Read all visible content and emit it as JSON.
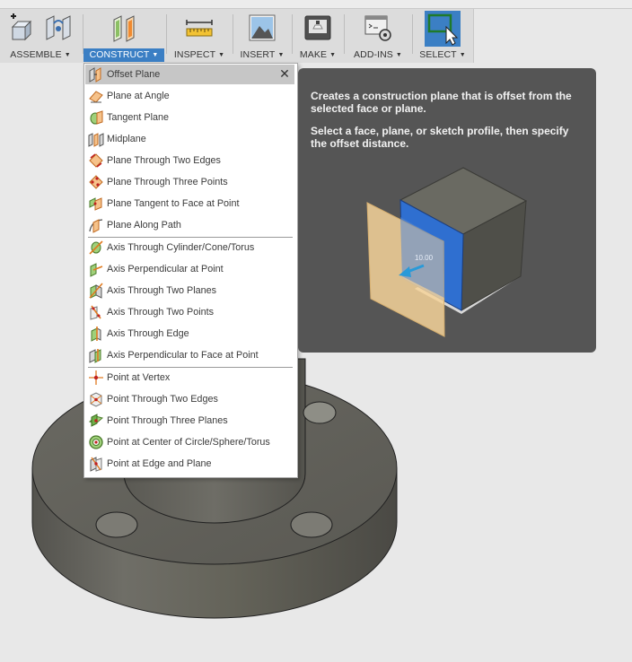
{
  "toolbar": {
    "groups": [
      {
        "label": "ASSEMBLE",
        "icon": "assemble-icon"
      },
      {
        "label": "CONSTRUCT",
        "icon": "construct-plane-icon",
        "active": true
      },
      {
        "label": "INSPECT",
        "icon": "measure-ruler-icon"
      },
      {
        "label": "INSERT",
        "icon": "insert-image-icon"
      },
      {
        "label": "MAKE",
        "icon": "3d-print-icon"
      },
      {
        "label": "ADD-INS",
        "icon": "scripts-gear-icon"
      },
      {
        "label": "SELECT",
        "icon": "select-cursor-icon"
      }
    ],
    "caret": "▼"
  },
  "construct_menu": {
    "close_glyph": "✕",
    "items": [
      {
        "label": "Offset Plane",
        "icon": "offset-plane-icon",
        "highlighted": true
      },
      {
        "label": "Plane at Angle",
        "icon": "plane-at-angle-icon"
      },
      {
        "label": "Tangent Plane",
        "icon": "tangent-plane-icon"
      },
      {
        "label": "Midplane",
        "icon": "midplane-icon"
      },
      {
        "label": "Plane Through Two Edges",
        "icon": "plane-two-edges-icon"
      },
      {
        "label": "Plane Through Three Points",
        "icon": "plane-three-points-icon"
      },
      {
        "label": "Plane Tangent to Face at Point",
        "icon": "plane-tangent-face-point-icon"
      },
      {
        "label": "Plane Along Path",
        "icon": "plane-along-path-icon"
      },
      {
        "label": "Axis Through Cylinder/Cone/Torus",
        "icon": "axis-cylinder-icon"
      },
      {
        "label": "Axis Perpendicular at Point",
        "icon": "axis-perpendicular-point-icon"
      },
      {
        "label": "Axis Through Two Planes",
        "icon": "axis-two-planes-icon"
      },
      {
        "label": "Axis Through Two Points",
        "icon": "axis-two-points-icon"
      },
      {
        "label": "Axis Through Edge",
        "icon": "axis-through-edge-icon"
      },
      {
        "label": "Axis Perpendicular to Face at Point",
        "icon": "axis-perpendicular-face-icon"
      },
      {
        "label": "Point at Vertex",
        "icon": "point-at-vertex-icon"
      },
      {
        "label": "Point Through Two Edges",
        "icon": "point-two-edges-icon"
      },
      {
        "label": "Point Through Three Planes",
        "icon": "point-three-planes-icon"
      },
      {
        "label": "Point at Center of Circle/Sphere/Torus",
        "icon": "point-center-circle-icon"
      },
      {
        "label": "Point at Edge and Plane",
        "icon": "point-edge-plane-icon"
      }
    ]
  },
  "tooltip": {
    "line1": "Creates a construction plane that is offset from the selected face or plane.",
    "line2": "Select a face, plane, or sketch profile, then specify the offset distance.",
    "illustration_value": "10.00"
  },
  "colors": {
    "accent": "#3b7fc4",
    "tooltip_bg": "#555555",
    "model": "#6b6a63",
    "canvas": "#e8e8e8"
  }
}
